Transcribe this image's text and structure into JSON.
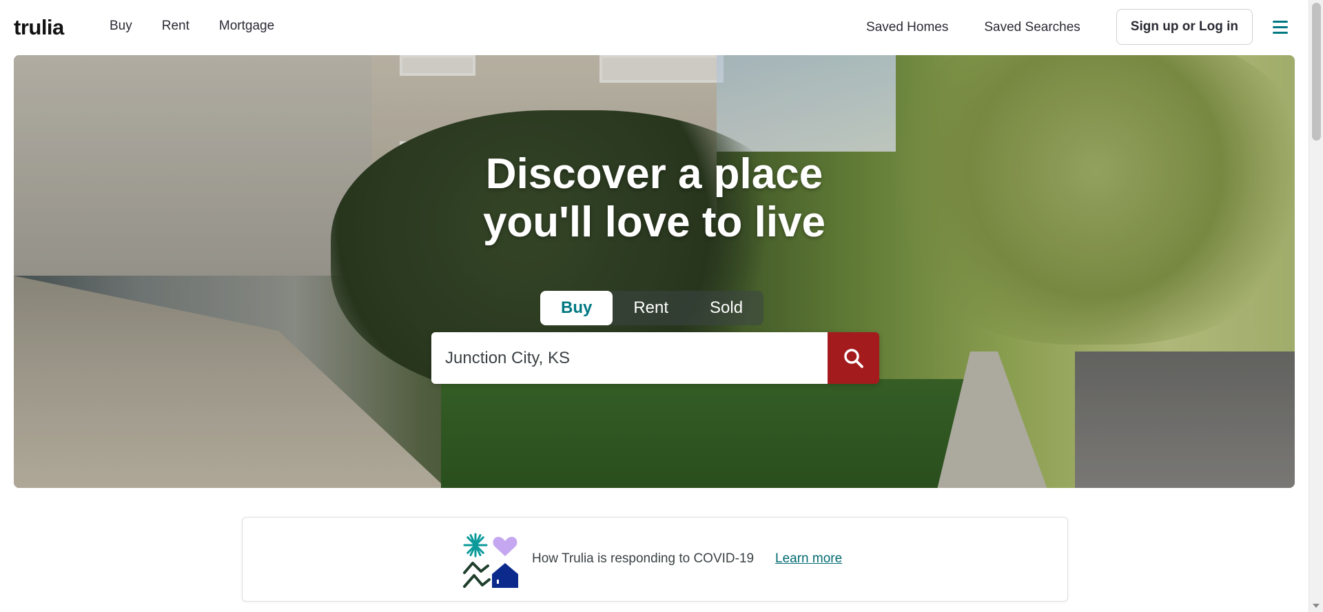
{
  "header": {
    "logo": "trulia",
    "nav_left": [
      "Buy",
      "Rent",
      "Mortgage"
    ],
    "nav_right": [
      "Saved Homes",
      "Saved Searches"
    ],
    "login": "Sign up or Log in",
    "menu_icon": "hamburger-menu-icon"
  },
  "hero": {
    "title_line1": "Discover a place",
    "title_line2": "you'll love to live",
    "tabs": [
      {
        "label": "Buy",
        "active": true
      },
      {
        "label": "Rent",
        "active": false
      },
      {
        "label": "Sold",
        "active": false
      }
    ],
    "search": {
      "value": "Junction City, KS",
      "button_icon": "search-icon"
    }
  },
  "covid_banner": {
    "text": "How Trulia is responding to COVID-19",
    "link": "Learn more",
    "icons": [
      "sparkle-icon",
      "heart-icon",
      "hills-icon",
      "house-icon"
    ]
  },
  "colors": {
    "brand_teal": "#007882",
    "search_red": "#a41b1e",
    "heart_lavender": "#c4a7f0",
    "house_navy": "#0b2a8c",
    "hills_green": "#1f3f2c"
  }
}
